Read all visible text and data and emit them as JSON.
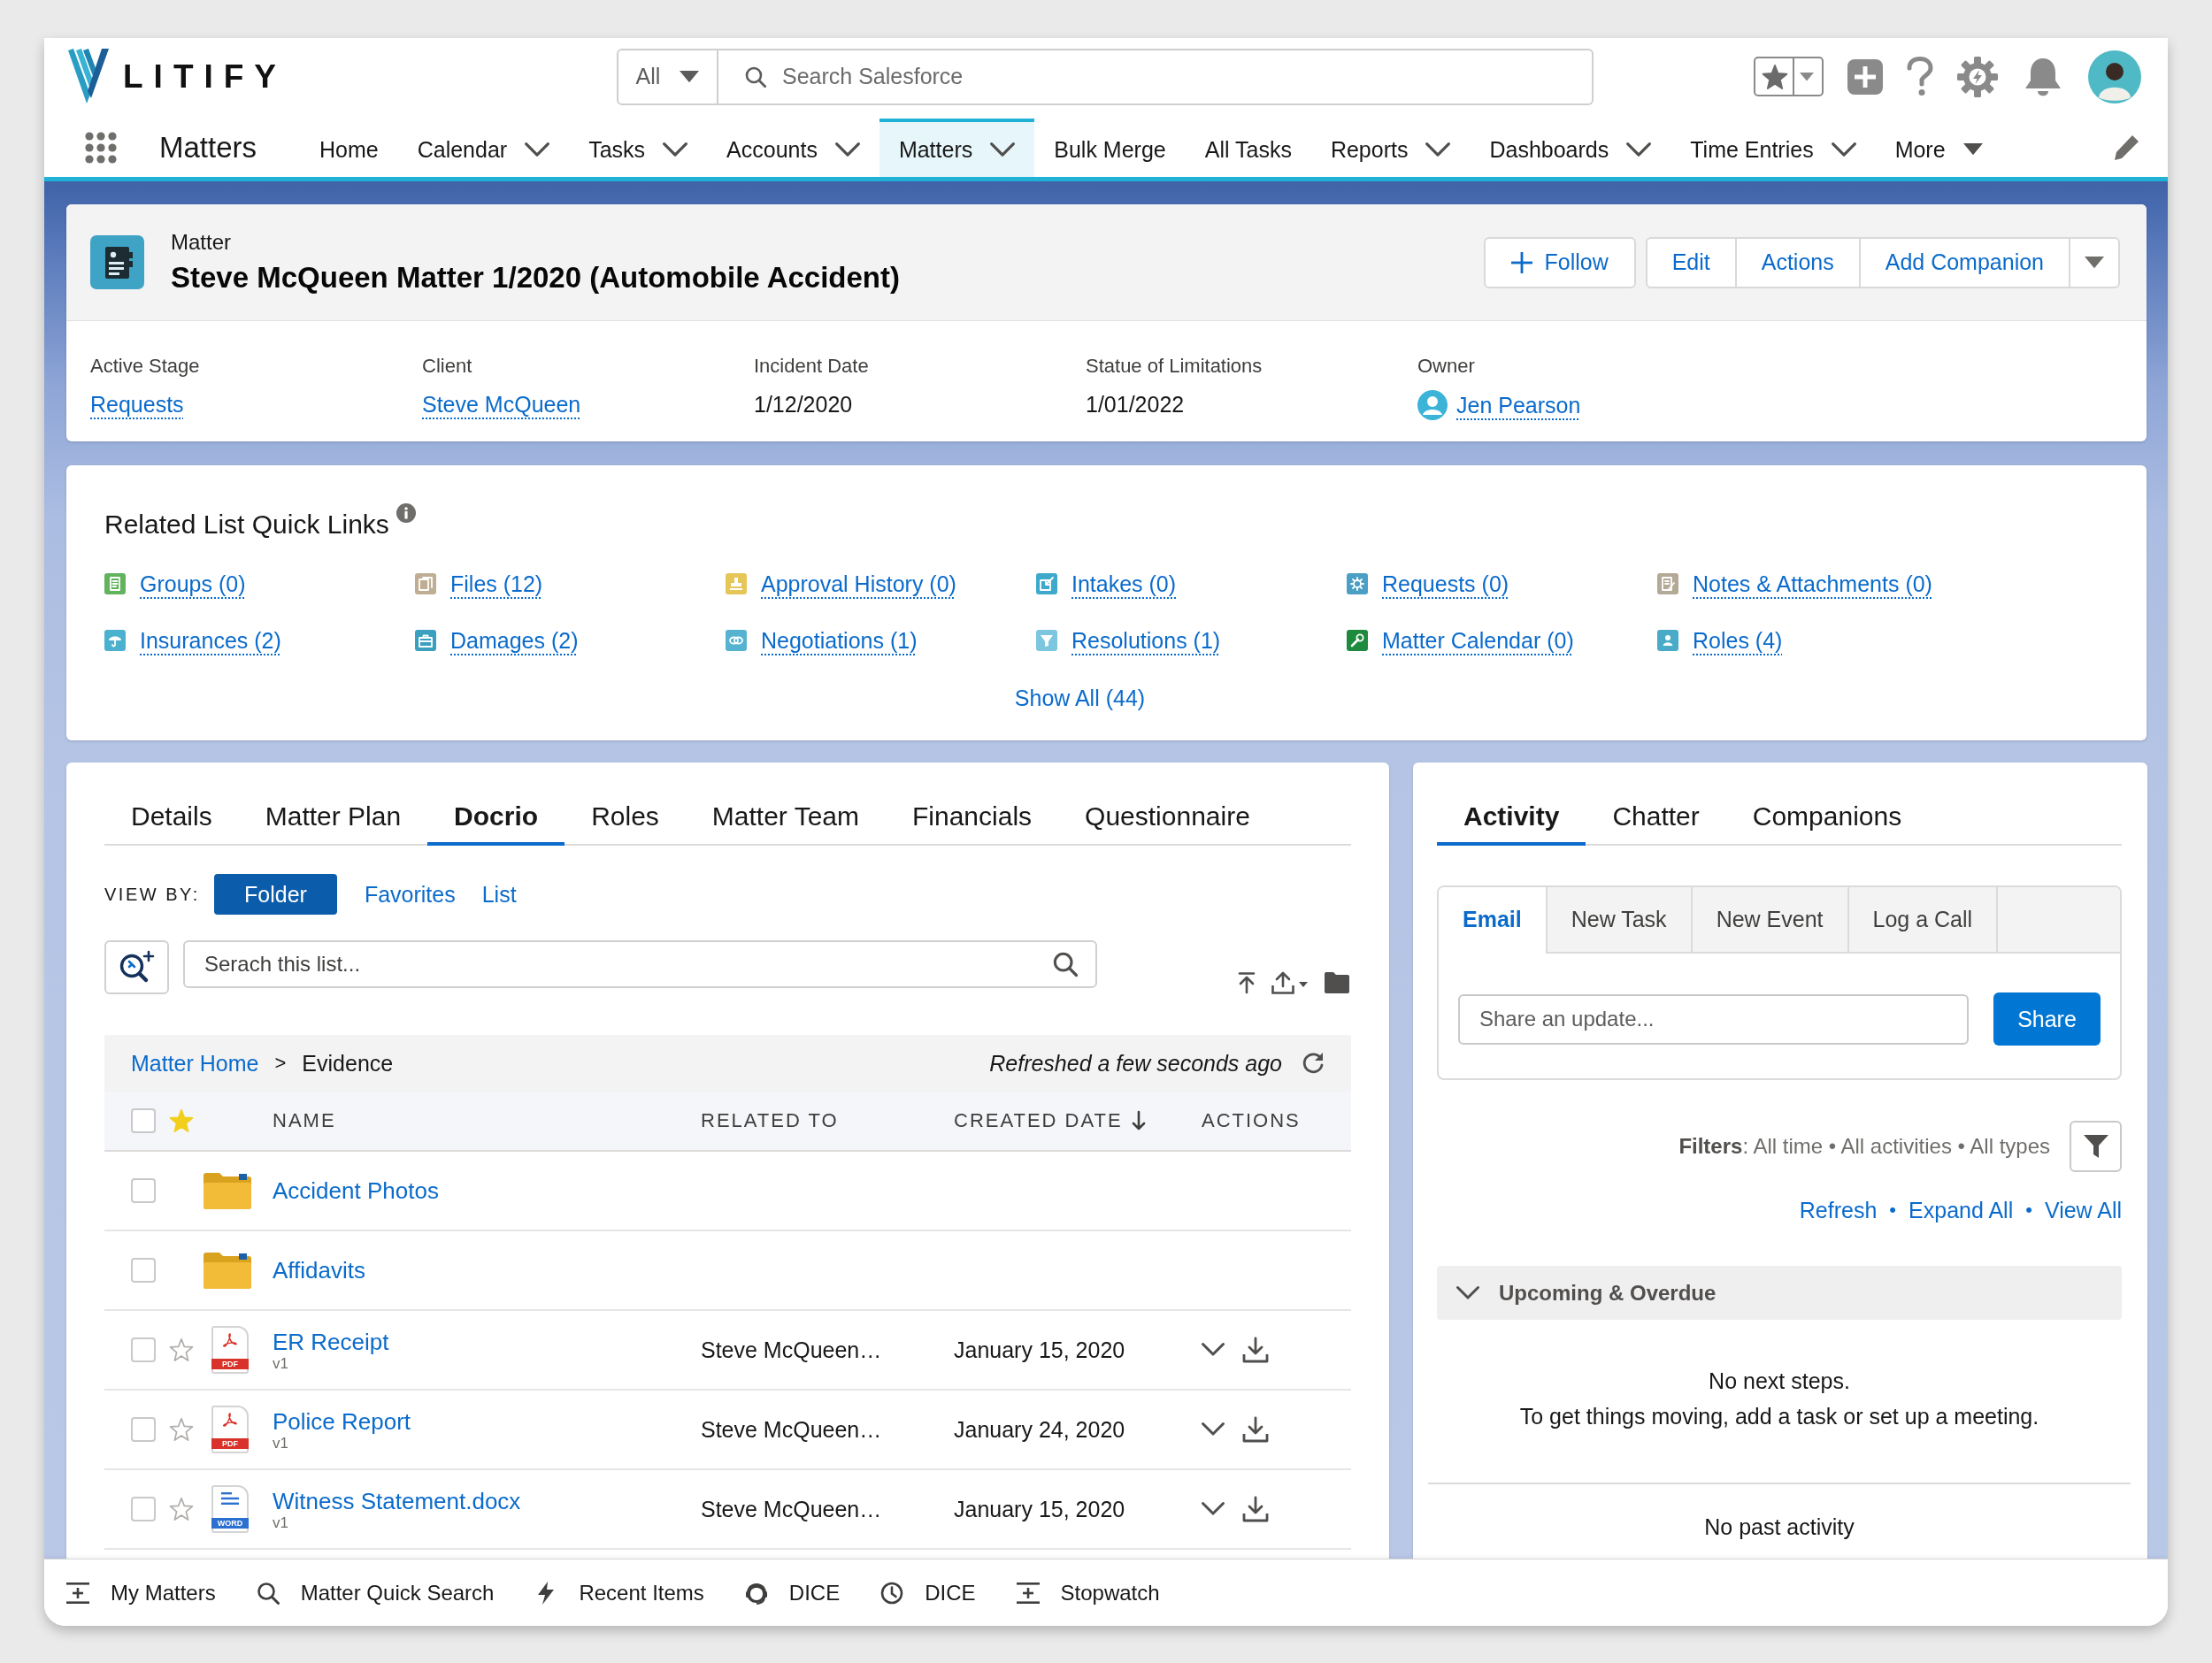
{
  "header": {
    "logo": "LITIFY",
    "search_scope": "All",
    "search_placeholder": "Search Salesforce"
  },
  "nav": {
    "app_name": "Matters",
    "items": [
      {
        "label": "Home",
        "selected": false,
        "kind": "link"
      },
      {
        "label": "Calendar",
        "selected": false,
        "kind": "dropdown"
      },
      {
        "label": "Tasks",
        "selected": false,
        "kind": "dropdown"
      },
      {
        "label": "Accounts",
        "selected": false,
        "kind": "dropdown"
      },
      {
        "label": "Matters",
        "selected": true,
        "kind": "dropdown"
      },
      {
        "label": "Bulk Merge",
        "selected": false,
        "kind": "link"
      },
      {
        "label": "All Tasks",
        "selected": false,
        "kind": "link"
      },
      {
        "label": "Reports",
        "selected": false,
        "kind": "dropdown"
      },
      {
        "label": "Dashboards",
        "selected": false,
        "kind": "dropdown"
      },
      {
        "label": "Time Entries",
        "selected": false,
        "kind": "dropdown"
      },
      {
        "label": "More",
        "selected": false,
        "kind": "overflow"
      }
    ]
  },
  "record": {
    "object_label": "Matter",
    "title": "Steve McQueen Matter 1/2020 (Automobile Accident)",
    "follow": "Follow",
    "actions": [
      "Edit",
      "Actions",
      "Add Companion"
    ],
    "fields": [
      {
        "label": "Active Stage",
        "value": "Requests",
        "kind": "link"
      },
      {
        "label": "Client",
        "value": "Steve McQueen",
        "kind": "link"
      },
      {
        "label": "Incident Date",
        "value": "1/12/2020",
        "kind": "text"
      },
      {
        "label": "Statue of Limitations",
        "value": "1/01/2022",
        "kind": "text"
      },
      {
        "label": "Owner",
        "value": "Jen Pearson",
        "kind": "user"
      }
    ]
  },
  "quick_links": {
    "title": "Related List Quick Links",
    "links": [
      {
        "label": "Groups (0)",
        "color": "#62b35e"
      },
      {
        "label": "Files (12)",
        "color": "#bfae94"
      },
      {
        "label": "Approval History (0)",
        "color": "#e6c657"
      },
      {
        "label": "Intakes (0)",
        "color": "#3fa9cb"
      },
      {
        "label": "Requests (0)",
        "color": "#4b9fc4"
      },
      {
        "label": "Notes & Attachments (0)",
        "color": "#b3a996"
      },
      {
        "label": "Insurances (2)",
        "color": "#4cb1cf"
      },
      {
        "label": "Damages (2)",
        "color": "#3b9fc0"
      },
      {
        "label": "Negotiations (1)",
        "color": "#55b3d1"
      },
      {
        "label": "Resolutions (1)",
        "color": "#7cc7df"
      },
      {
        "label": "Matter Calendar (0)",
        "color": "#1e8a3e"
      },
      {
        "label": "Roles (4)",
        "color": "#4aabc8"
      }
    ],
    "show_all": "Show All (44)"
  },
  "details": {
    "tabs": [
      {
        "label": "Details",
        "selected": false
      },
      {
        "label": "Matter Plan",
        "selected": false
      },
      {
        "label": "Docrio",
        "selected": true
      },
      {
        "label": "Roles",
        "selected": false
      },
      {
        "label": "Matter Team",
        "selected": false
      },
      {
        "label": "Financials",
        "selected": false
      },
      {
        "label": "Questionnaire",
        "selected": false
      }
    ],
    "view_by": {
      "label": "VIEW BY:",
      "options": [
        {
          "label": "Folder",
          "selected": true
        },
        {
          "label": "Favorites",
          "selected": false
        },
        {
          "label": "List",
          "selected": false
        }
      ]
    },
    "search_placeholder": "Serach this list...",
    "breadcrumb": {
      "items": [
        "Matter Home",
        "Evidence"
      ],
      "separator": ">",
      "refreshed": "Refreshed a few seconds ago"
    },
    "table": {
      "all_checked": false,
      "columns": [
        {
          "label": "NAME",
          "sorted": false
        },
        {
          "label": "RELATED TO",
          "sorted": false
        },
        {
          "label": "CREATED DATE",
          "sorted": true
        },
        {
          "label": "ACTIONS",
          "sorted": false
        }
      ],
      "rows": [
        {
          "kind": "folder",
          "name": "Accident Photos",
          "checked": false
        },
        {
          "kind": "folder",
          "name": "Affidavits",
          "checked": false
        },
        {
          "kind": "pdf",
          "file_type": "PDF",
          "name": "ER Receipt",
          "version": "v1",
          "related_to": "Steve McQueen…",
          "created": "January 15, 2020",
          "favorite": false,
          "checked": false
        },
        {
          "kind": "pdf",
          "file_type": "PDF",
          "name": "Police Report",
          "version": "v1",
          "related_to": "Steve McQueen…",
          "created": "January 24, 2020",
          "favorite": false,
          "checked": false
        },
        {
          "kind": "word",
          "file_type": "WORD",
          "name": "Witness Statement.docx",
          "version": "v1",
          "related_to": "Steve McQueen…",
          "created": "January 15, 2020",
          "favorite": false,
          "checked": false
        }
      ]
    }
  },
  "activity": {
    "tabs": [
      {
        "label": "Activity",
        "selected": true
      },
      {
        "label": "Chatter",
        "selected": false
      },
      {
        "label": "Companions",
        "selected": false
      }
    ],
    "publisher": {
      "tabs": [
        {
          "label": "Email",
          "selected": true
        },
        {
          "label": "New Task",
          "selected": false
        },
        {
          "label": "New Event",
          "selected": false
        },
        {
          "label": "Log a Call",
          "selected": false
        }
      ],
      "placeholder": "Share an update...",
      "button": "Share"
    },
    "filters": "**Filters**: All time • All activities • All types",
    "links": [
      "Refresh",
      "Expand All",
      "View All"
    ],
    "separator": "•",
    "section": {
      "title": "Upcoming & Overdue",
      "expanded": true
    },
    "empty_title": "No next steps.",
    "empty_text": "To get things moving, add a task or set up a meeting.",
    "past": "No past activity"
  },
  "utility_bar": [
    "My Matters",
    "Matter Quick Search",
    "Recent Items",
    "DICE",
    "DICE",
    "Stopwatch"
  ]
}
